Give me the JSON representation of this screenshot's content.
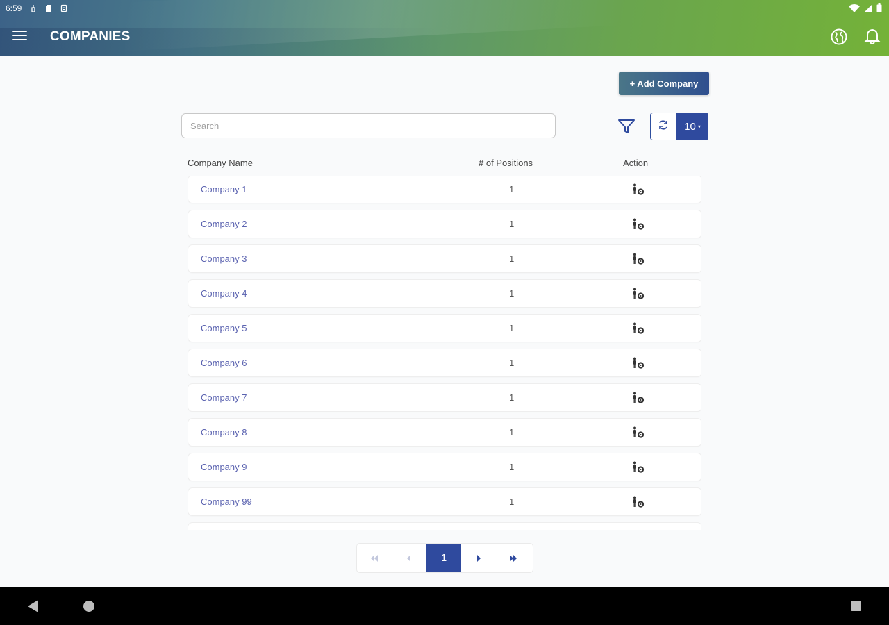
{
  "status_bar": {
    "time": "6:59",
    "icons": [
      "battery-saver-icon",
      "sd-card-icon",
      "storage-icon"
    ],
    "right_icons": [
      "wifi-icon",
      "cell-signal-icon",
      "battery-icon"
    ]
  },
  "app_bar": {
    "title": "COMPANIES",
    "menu_icon": "hamburger-menu-icon",
    "globe_icon": "globe-icon",
    "bell_icon": "bell-icon"
  },
  "toolbar": {
    "add_label": "+ Add Company",
    "search_placeholder": "Search",
    "search_value": "",
    "filter_icon": "filter-icon",
    "refresh_icon": "refresh-icon",
    "page_size": "10"
  },
  "table": {
    "columns": [
      "Company Name",
      "# of Positions",
      "Action"
    ],
    "rows": [
      {
        "name": "Company 1",
        "positions": "1"
      },
      {
        "name": "Company 2",
        "positions": "1"
      },
      {
        "name": "Company 3",
        "positions": "1"
      },
      {
        "name": "Company 4",
        "positions": "1"
      },
      {
        "name": "Company 5",
        "positions": "1"
      },
      {
        "name": "Company 6",
        "positions": "1"
      },
      {
        "name": "Company 7",
        "positions": "1"
      },
      {
        "name": "Company 8",
        "positions": "1"
      },
      {
        "name": "Company 9",
        "positions": "1"
      },
      {
        "name": "Company 99",
        "positions": "1"
      },
      {
        "name": "",
        "positions": ""
      }
    ],
    "action_icon": "user-settings-icon"
  },
  "pagination": {
    "first": "«",
    "prev": "‹",
    "current": "1",
    "next": "›",
    "last": "»"
  },
  "colors": {
    "primary": "#2f4a9e",
    "link": "#5b63b0",
    "header_gradient_start": "#3c6288",
    "header_gradient_end": "#74b238"
  }
}
